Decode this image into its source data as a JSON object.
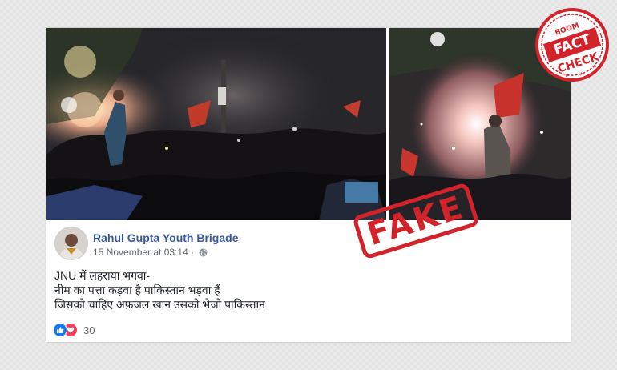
{
  "post": {
    "author": "Rahul Gupta Youth Brigade",
    "timestamp": "15 November at 03:14",
    "lines": [
      "JNU में लहराया भगवा-",
      "नीम का पत्ता कड़वा है पाकिस्तान भड़वा हैं",
      "जिसको चाहिए अफ़जल खान उसको भेजो पाकिस्तान"
    ],
    "reaction_count": "30"
  },
  "stamp": {
    "text": "FAKE"
  },
  "badge": {
    "top": "BOOM",
    "line1": "FACT",
    "line2": "CHECK"
  },
  "colors": {
    "stamp_red": "#d2232a",
    "link_blue": "#385898",
    "like_blue": "#1877f2",
    "love_red": "#f33e58"
  },
  "icons": [
    "globe-icon",
    "like-reaction-icon",
    "love-reaction-icon"
  ]
}
